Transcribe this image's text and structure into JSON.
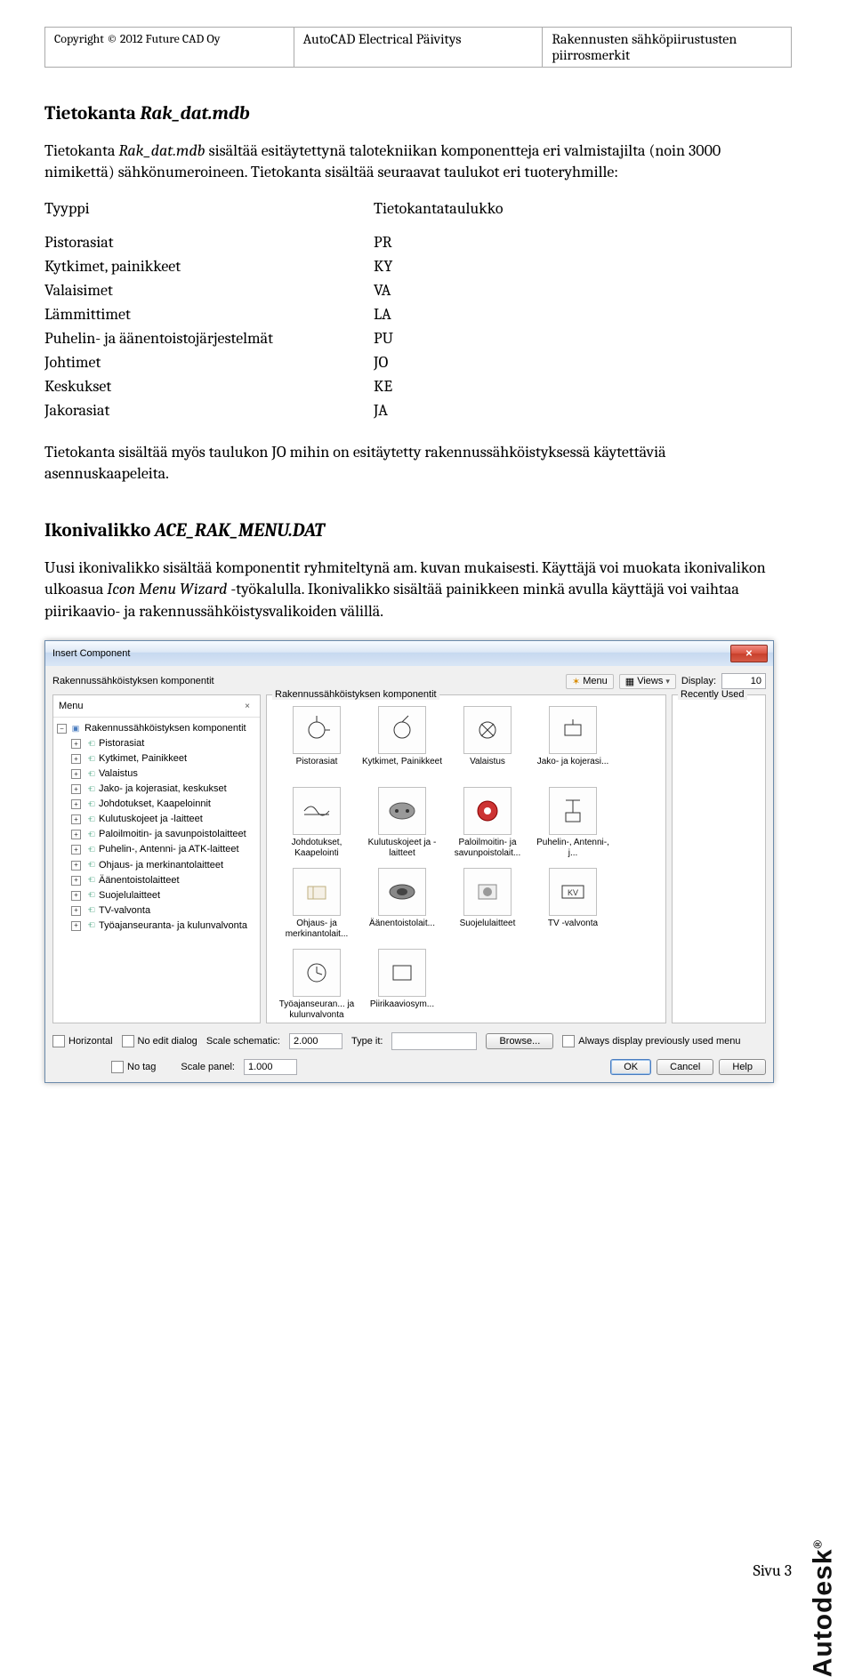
{
  "header": {
    "left": "Copyright © 2012 Future CAD Oy",
    "center": "AutoCAD Electrical Päivitys",
    "right": "Rakennusten sähköpiirustusten piirrosmerkit"
  },
  "section1": {
    "title_plain": "Tietokanta ",
    "title_ital": "Rak_dat.mdb",
    "p1a": "Tietokanta ",
    "p1b": "Rak_dat.mdb",
    "p1c": " sisältää esitäytettynä talotekniikan komponentteja eri valmistajilta (noin 3000 nimikettä) sähkönumeroineen. Tietokanta sisältää seuraavat taulukot eri tuoteryhmille:",
    "table": {
      "head_l": "Tyyppi",
      "head_r": "Tietokantataulukko",
      "rows": [
        {
          "l": "Pistorasiat",
          "r": "PR"
        },
        {
          "l": "Kytkimet, painikkeet",
          "r": "KY"
        },
        {
          "l": "Valaisimet",
          "r": "VA"
        },
        {
          "l": "Lämmittimet",
          "r": "LA"
        },
        {
          "l": "Puhelin- ja äänentoistojärjestelmät",
          "r": "PU"
        },
        {
          "l": "Johtimet",
          "r": "JO"
        },
        {
          "l": "Keskukset",
          "r": "KE"
        },
        {
          "l": "Jakorasiat",
          "r": "JA"
        }
      ]
    },
    "p2": "Tietokanta sisältää myös  taulukon JO mihin on esitäytetty rakennussähköistyksessä käytettäviä asennuskaapeleita."
  },
  "section2": {
    "title_plain": "Ikonivalikko ",
    "title_ital": "ACE_RAK_MENU.DAT",
    "p1a": "Uusi ikonivalikko sisältää komponentit ryhmiteltynä am. kuvan mukaisesti. Käyttäjä voi muokata ikonivalikon ulkoasua ",
    "p1b": "Icon Menu Wizard",
    "p1c": " -työkalulla. Ikonivalikko sisältää painikkeen minkä avulla käyttäjä voi vaihtaa piirikaavio-  ja rakennussähköistysvalikoiden välillä."
  },
  "dialog": {
    "title": "Insert Component",
    "subtitle": "Rakennussähköistyksen komponentit",
    "menu_btn": "Menu",
    "views_btn": "Views",
    "display_label": "Display:",
    "display_value": "10",
    "menu_panel_title": "Menu",
    "main_panel_title": "Rakennussähköistyksen komponentit",
    "recent_panel_title": "Recently Used",
    "tree_root": "Rakennussähköistyksen komponentit",
    "tree_items": [
      "Pistorasiat",
      "Kytkimet, Painikkeet",
      "Valaistus",
      "Jako- ja kojerasiat, keskukset",
      "Johdotukset, Kaapeloinnit",
      "Kulutuskojeet ja -laitteet",
      "Paloilmoitin- ja savunpoistolaitteet",
      "Puhelin-, Antenni- ja ATK-laitteet",
      "Ohjaus- ja merkinantolaitteet",
      "Äänentoistolaitteet",
      "Suojelulaitteet",
      "TV-valvonta",
      "Työajanseuranta- ja kulunvalvonta"
    ],
    "icons": [
      {
        "label": "Pistorasiat",
        "shape": "socket"
      },
      {
        "label": "Kytkimet, Painikkeet",
        "shape": "switch"
      },
      {
        "label": "Valaistus",
        "shape": "lamp"
      },
      {
        "label": "Jako- ja kojerasi...",
        "shape": "box"
      },
      {
        "label": "Johdotukset, Kaapelointi",
        "shape": "cable"
      },
      {
        "label": "Kulutuskojeet ja -laitteet",
        "shape": "plug"
      },
      {
        "label": "Paloilmoitin- ja savunpoistolait...",
        "shape": "alarm"
      },
      {
        "label": "Puhelin-, Antenni-, j...",
        "shape": "antenna"
      },
      {
        "label": "Ohjaus- ja merkinantolait...",
        "shape": "control"
      },
      {
        "label": "Äänentoistolait...",
        "shape": "speaker"
      },
      {
        "label": "Suojelulaitteet",
        "shape": "camera"
      },
      {
        "label": "TV -valvonta",
        "shape": "kv"
      },
      {
        "label": "Työajanseuran... ja kulunvalvonta",
        "shape": "clock"
      },
      {
        "label": "Piirikaaviosym...",
        "shape": "schem"
      }
    ],
    "bottom": {
      "horizontal": "Horizontal",
      "noedit": "No edit dialog",
      "notag": "No tag",
      "scale_schematic_label": "Scale schematic:",
      "scale_schematic_value": "2.000",
      "scale_panel_label": "Scale panel:",
      "scale_panel_value": "1.000",
      "type_it": "Type it:",
      "browse": "Browse...",
      "always": "Always display previously used menu",
      "ok": "OK",
      "cancel": "Cancel",
      "help": "Help"
    }
  },
  "logo": "Autodesk",
  "page_num": "Sivu 3"
}
